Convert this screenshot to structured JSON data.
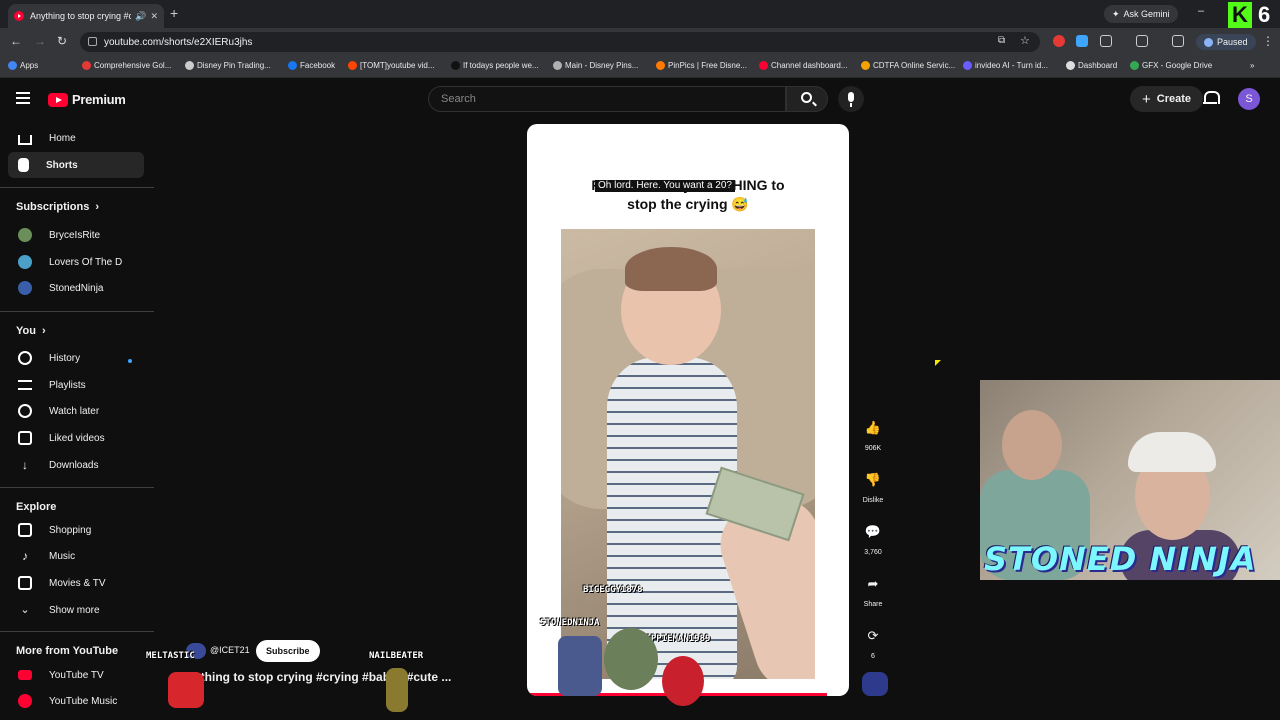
{
  "browser": {
    "tab_title": "Anything to stop crying #c",
    "new_tab": "+",
    "ask_gemini": "Ask Gemini",
    "url": "youtube.com/shorts/e2XIERu3jhs",
    "profile_status": "Paused",
    "kick_badge": "K",
    "kick_count": "6"
  },
  "bookmarks": [
    {
      "label": "Apps",
      "color": "#4285f4"
    },
    {
      "label": "Comprehensive Gol...",
      "color": "#e53935"
    },
    {
      "label": "Disney Pin Trading...",
      "color": "#cccccc"
    },
    {
      "label": "Facebook",
      "color": "#1877f2"
    },
    {
      "label": "[TOMT]youtube vid...",
      "color": "#ff4500"
    },
    {
      "label": "If todays people we...",
      "color": "#111111"
    },
    {
      "label": "Main - Disney Pins...",
      "color": "#b0b0b0"
    },
    {
      "label": "PinPics | Free Disne...",
      "color": "#ff7a00"
    },
    {
      "label": "Channel dashboard...",
      "color": "#ff0033"
    },
    {
      "label": "CDTFA Online Servic...",
      "color": "#f4a300"
    },
    {
      "label": "invideo AI - Turn id...",
      "color": "#6a5cff"
    },
    {
      "label": "Dashboard",
      "color": "#dddddd"
    },
    {
      "label": "GFX - Google Drive",
      "color": "#34a853"
    }
  ],
  "youtube": {
    "logo_text": "Premium",
    "search_placeholder": "Search",
    "create_label": "Create",
    "avatar_letter": "S"
  },
  "sidebar": {
    "main": [
      {
        "label": "Home",
        "icon": "home-icon"
      },
      {
        "label": "Shorts",
        "icon": "shorts-icon"
      }
    ],
    "subscriptions_heading": "Subscriptions",
    "subscriptions": [
      {
        "label": "BryceIsRite",
        "color": "#6b8f5a"
      },
      {
        "label": "Lovers Of The D",
        "color": "#4aa0c8"
      },
      {
        "label": "StonedNinja",
        "color": "#3a5fa8"
      }
    ],
    "you_heading": "You",
    "you": [
      {
        "label": "History",
        "icon": "history-icon"
      },
      {
        "label": "Playlists",
        "icon": "playlists-icon"
      },
      {
        "label": "Watch later",
        "icon": "watch-later-icon"
      },
      {
        "label": "Liked videos",
        "icon": "liked-videos-icon"
      },
      {
        "label": "Downloads",
        "icon": "downloads-icon"
      }
    ],
    "explore_heading": "Explore",
    "explore": [
      {
        "label": "Shopping",
        "icon": "shopping-icon"
      },
      {
        "label": "Music",
        "icon": "music-icon"
      },
      {
        "label": "Movies & TV",
        "icon": "movies-icon"
      },
      {
        "label": "Show more",
        "icon": "chevron-down-icon"
      }
    ],
    "more_heading": "More from YouTube",
    "more": [
      {
        "label": "YouTube TV"
      },
      {
        "label": "YouTube Music"
      }
    ]
  },
  "short": {
    "caption_line1": "Parents will try ANYTHING to",
    "caption_line2": "stop the crying 😅",
    "subtitle": "Oh lord. Here. You want a 20?",
    "watermark": "BIGEGGY1878"
  },
  "actions": {
    "like_count": "906K",
    "dislike_label": "Dislike",
    "comment_count": "3,760",
    "share_label": "Share",
    "remix_count": "6"
  },
  "overlay": {
    "channel_handle": "@ICET21",
    "subscribe_label": "Subscribe",
    "video_title": "ything to stop crying #crying #babys #cute ...",
    "names": {
      "meltastic": "MELTASTIC",
      "nailbeater": "NAILBEATER",
      "stonedninja": "STONEDNINJA",
      "hippieman": "HIPPIEMAN1989"
    }
  },
  "webcam": {
    "title": "STONED NINJA"
  }
}
